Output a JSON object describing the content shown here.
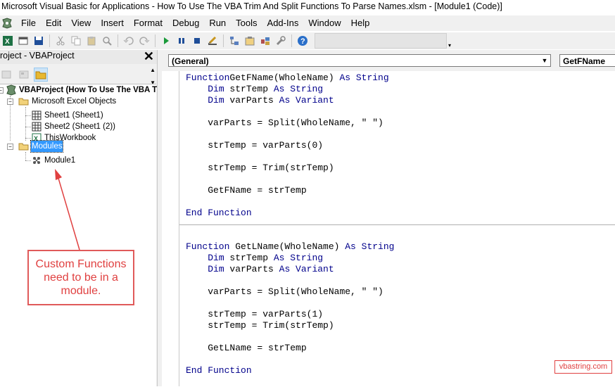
{
  "window": {
    "title": "Microsoft Visual Basic for Applications - How To Use The VBA Trim And Split Functions To Parse Names.xlsm - [Module1 (Code)]"
  },
  "menu": [
    "File",
    "Edit",
    "View",
    "Insert",
    "Format",
    "Debug",
    "Run",
    "Tools",
    "Add-Ins",
    "Window",
    "Help"
  ],
  "toolbar": {
    "icons": [
      "excel-icon",
      "insert-userform-icon",
      "save-icon",
      "cut-icon",
      "copy-icon",
      "paste-icon",
      "find-icon",
      "undo-icon",
      "redo-icon",
      "run-icon",
      "break-icon",
      "reset-icon",
      "design-mode-icon",
      "project-explorer-icon",
      "properties-icon",
      "object-browser-icon",
      "toolbox-icon",
      "help-icon"
    ]
  },
  "project": {
    "title": "roject - VBAProject",
    "close": "✕",
    "tree": {
      "root": "VBAProject (How To Use The VBA T",
      "excel_objects": "Microsoft Excel Objects",
      "sheet1": "Sheet1 (Sheet1)",
      "sheet2": "Sheet2 (Sheet1 (2))",
      "workbook": "ThisWorkbook",
      "modules": "Modules",
      "module1": "Module1"
    }
  },
  "code_window": {
    "object_combo": "(General)",
    "procedure_combo": "GetFName",
    "procedures": [
      [
        {
          "indent": "",
          "parts": [
            [
              "kw",
              "Function"
            ],
            [
              "",
              "GetFName(WholeName) "
            ],
            [
              "kw",
              "As String"
            ]
          ]
        },
        {
          "indent": "    ",
          "parts": [
            [
              "kw",
              "Dim"
            ],
            [
              "",
              " strTemp "
            ],
            [
              "kw",
              "As String"
            ]
          ]
        },
        {
          "indent": "    ",
          "parts": [
            [
              "kw",
              "Dim"
            ],
            [
              "",
              " varParts "
            ],
            [
              "kw",
              "As Variant"
            ]
          ]
        },
        {
          "indent": "",
          "parts": []
        },
        {
          "indent": "    ",
          "parts": [
            [
              "",
              "varParts = Split(WholeName, \" \")"
            ]
          ]
        },
        {
          "indent": "",
          "parts": []
        },
        {
          "indent": "    ",
          "parts": [
            [
              "",
              "strTemp = varParts(0)"
            ]
          ]
        },
        {
          "indent": "",
          "parts": []
        },
        {
          "indent": "    ",
          "parts": [
            [
              "",
              "strTemp = Trim(strTemp)"
            ]
          ]
        },
        {
          "indent": "",
          "parts": []
        },
        {
          "indent": "    ",
          "parts": [
            [
              "",
              "GetFName = strTemp"
            ]
          ]
        },
        {
          "indent": "",
          "parts": []
        },
        {
          "indent": "",
          "parts": [
            [
              "kw",
              "End Function"
            ]
          ]
        }
      ],
      [
        {
          "indent": "",
          "parts": [
            [
              "kw",
              "Function"
            ],
            [
              "",
              " GetLName(WholeName) "
            ],
            [
              "kw",
              "As String"
            ]
          ]
        },
        {
          "indent": "    ",
          "parts": [
            [
              "kw",
              "Dim"
            ],
            [
              "",
              " strTemp "
            ],
            [
              "kw",
              "As String"
            ]
          ]
        },
        {
          "indent": "    ",
          "parts": [
            [
              "kw",
              "Dim"
            ],
            [
              "",
              " varParts "
            ],
            [
              "kw",
              "As Variant"
            ]
          ]
        },
        {
          "indent": "",
          "parts": []
        },
        {
          "indent": "    ",
          "parts": [
            [
              "",
              "varParts = Split(WholeName, \" \")"
            ]
          ]
        },
        {
          "indent": "",
          "parts": []
        },
        {
          "indent": "    ",
          "parts": [
            [
              "",
              "strTemp = varParts(1)"
            ]
          ]
        },
        {
          "indent": "    ",
          "parts": [
            [
              "",
              "strTemp = Trim(strTemp)"
            ]
          ]
        },
        {
          "indent": "",
          "parts": []
        },
        {
          "indent": "    ",
          "parts": [
            [
              "",
              "GetLName = strTemp"
            ]
          ]
        },
        {
          "indent": "",
          "parts": []
        },
        {
          "indent": "",
          "parts": [
            [
              "kw",
              "End Function"
            ]
          ]
        }
      ]
    ]
  },
  "annotation": {
    "callout": "Custom Functions need to be in a module.",
    "watermark": "vbastring.com"
  },
  "colors": {
    "keyword": "#00008b",
    "callout": "#e04040",
    "selection": "#3399ff"
  }
}
